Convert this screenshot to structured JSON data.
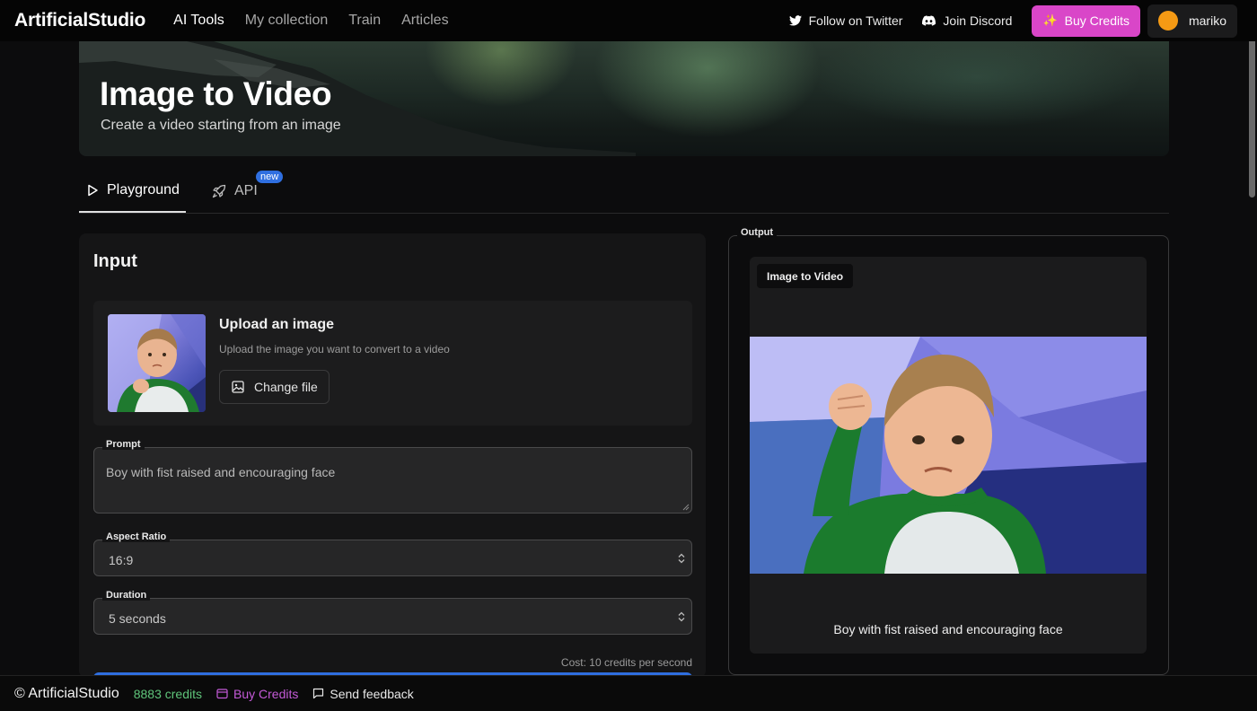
{
  "nav": {
    "brand": "ArtificialStudio",
    "links": [
      "AI Tools",
      "My collection",
      "Train",
      "Articles"
    ],
    "active_link": "AI Tools",
    "twitter": "Follow on Twitter",
    "discord": "Join Discord",
    "buy_credits": "Buy Credits",
    "username": "mariko"
  },
  "hero": {
    "title": "Image to Video",
    "subtitle": "Create a video starting from an image"
  },
  "tabs": {
    "playground": "Playground",
    "api": "API",
    "api_badge": "new"
  },
  "input": {
    "title": "Input",
    "upload_title": "Upload an image",
    "upload_subtitle": "Upload the image you want to convert to a video",
    "change_file": "Change file",
    "prompt_label": "Prompt",
    "prompt_value": "Boy with fist raised and encouraging face",
    "aspect_label": "Aspect Ratio",
    "aspect_value": "16:9",
    "duration_label": "Duration",
    "duration_value": "5 seconds",
    "cost": "Cost: 10 credits per second"
  },
  "output": {
    "label": "Output",
    "tag": "Image to Video",
    "caption": "Boy with fist raised and encouraging face"
  },
  "footer": {
    "brand": "© ArtificialStudio",
    "credits": "8883 credits",
    "buy_credits": "Buy Credits",
    "feedback": "Send feedback"
  },
  "colors": {
    "accent_pink": "#d946c8",
    "accent_blue": "#2f6fe0",
    "credits_green": "#5fc47a",
    "avatar_orange": "#f59a14"
  }
}
